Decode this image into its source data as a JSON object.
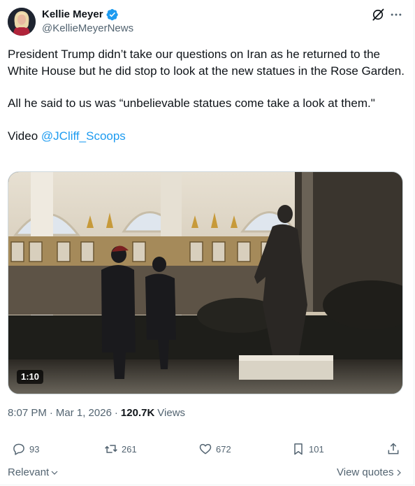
{
  "author": {
    "name": "Kellie Meyer",
    "handle": "@KellieMeyerNews",
    "verified": true
  },
  "header_icons": [
    "grok-icon",
    "more-icon"
  ],
  "tweet": {
    "line1": "President Trump didn’t take our questions on Iran as he returned to the White House but he did stop to look at the new statues in the Rose Garden.",
    "line2": "All he said to us was “unbelievable statues come take a look at them.\"",
    "video_prefix": "Video",
    "video_mention": "@JCliff_Scoops"
  },
  "media": {
    "type": "video",
    "duration": "1:10"
  },
  "meta": {
    "time": "8:07 PM",
    "separator": "·",
    "date": "Mar 1, 2026",
    "views_count": "120.7K",
    "views_label": "Views"
  },
  "actions": {
    "replies": "93",
    "reposts": "261",
    "likes": "672",
    "bookmarks": "101"
  },
  "footer": {
    "sort_label": "Relevant",
    "quotes_label": "View quotes"
  },
  "colors": {
    "accent": "#1d9bf0",
    "text": "#0f1419",
    "muted": "#536471"
  }
}
